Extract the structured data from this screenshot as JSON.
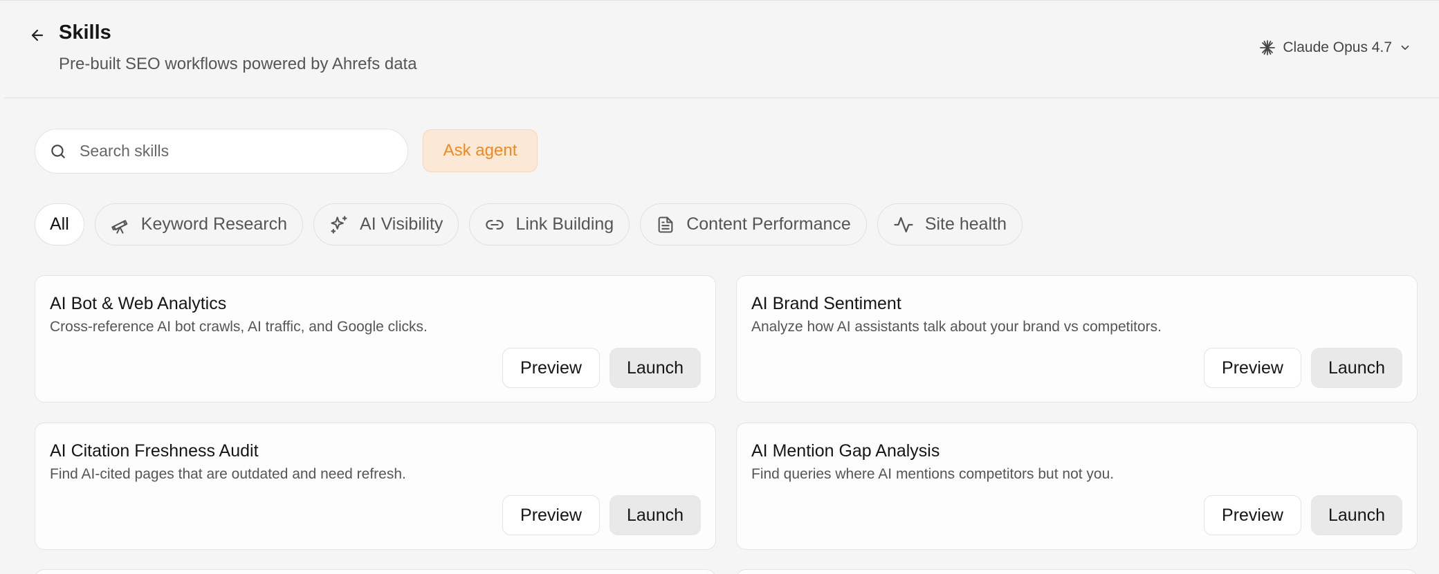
{
  "header": {
    "title": "Skills",
    "subtitle": "Pre-built SEO workflows powered by Ahrefs data",
    "model": "Claude Opus 4.7"
  },
  "search": {
    "placeholder": "Search skills",
    "value": ""
  },
  "ask_agent_label": "Ask agent",
  "filters": [
    {
      "label": "All",
      "icon": "none",
      "active": true
    },
    {
      "label": "Keyword Research",
      "icon": "telescope-icon",
      "active": false
    },
    {
      "label": "AI Visibility",
      "icon": "sparkles-icon",
      "active": false
    },
    {
      "label": "Link Building",
      "icon": "link-icon",
      "active": false
    },
    {
      "label": "Content Performance",
      "icon": "document-icon",
      "active": false
    },
    {
      "label": "Site health",
      "icon": "activity-icon",
      "active": false
    }
  ],
  "cards": [
    {
      "title": "AI Bot & Web Analytics",
      "description": "Cross-reference AI bot crawls, AI traffic, and Google clicks.",
      "preview_label": "Preview",
      "launch_label": "Launch"
    },
    {
      "title": "AI Brand Sentiment",
      "description": "Analyze how AI assistants talk about your brand vs competitors.",
      "preview_label": "Preview",
      "launch_label": "Launch"
    },
    {
      "title": "AI Citation Freshness Audit",
      "description": "Find AI-cited pages that are outdated and need refresh.",
      "preview_label": "Preview",
      "launch_label": "Launch"
    },
    {
      "title": "AI Mention Gap Analysis",
      "description": "Find queries where AI mentions competitors but not you.",
      "preview_label": "Preview",
      "launch_label": "Launch"
    }
  ],
  "colors": {
    "background": "#f5f5f5",
    "accent_orange": "#f08a1e",
    "accent_orange_bg": "#fce8d6"
  }
}
